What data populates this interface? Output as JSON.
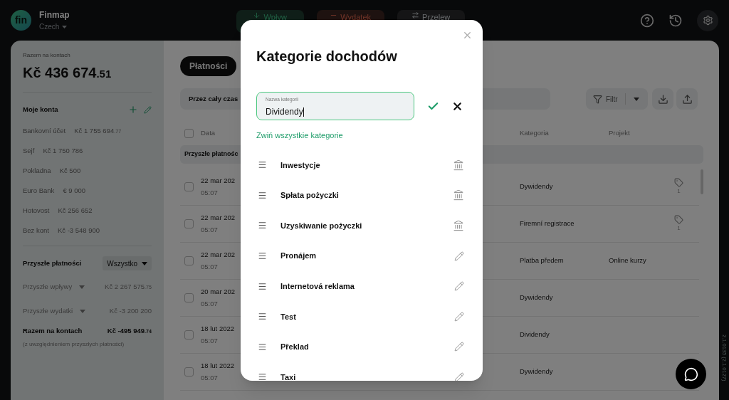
{
  "app": {
    "name": "Finmap",
    "language": "Czech",
    "logo": "fin"
  },
  "top_buttons": [
    {
      "label": "Wpływ",
      "kind": "income"
    },
    {
      "label": "Wydatek",
      "kind": "expense"
    },
    {
      "label": "Przelew",
      "kind": "transfer"
    }
  ],
  "sidebar": {
    "total_label": "Razem na kontach",
    "total": "Kč 436 674",
    "total_cents": ".51",
    "accounts_title": "Moje konta",
    "accounts": [
      {
        "name": "Bankovní účet",
        "amount": "Kč 1 755 694",
        "cents": ".77"
      },
      {
        "name": "Sejf",
        "amount": "Kč 1 750 786"
      },
      {
        "name": "Pokladna",
        "amount": "Kč 500"
      },
      {
        "name": "Euro Bank",
        "amount": "€ 9 000"
      },
      {
        "name": "Hotovost",
        "amount": "Kč 256 652"
      },
      {
        "name": "Bez kont",
        "amount": "Kč -3 548 900"
      }
    ],
    "future_title": "Przyszłe płatności",
    "future_filter": "Wszystko",
    "future": [
      {
        "name": "Przyszłe wpływy",
        "amount": "Kč 2 267 575",
        "cents": ".75"
      },
      {
        "name": "Przyszłe wydatki",
        "amount": "Kč -3 200 200"
      }
    ],
    "grand_label": "Razem na kontach",
    "grand_total": "Kč -495 949",
    "grand_cents": ".74",
    "grand_note": "(z uwzględnieniem przyszłych płatności)"
  },
  "tabs": [
    {
      "label": "Płatności",
      "selected": true
    }
  ],
  "period": "Przez cały czas",
  "filter_button": "Filtr",
  "table": {
    "select_all_checked": false,
    "columns": [
      "Data",
      "Kategoria",
      "Projekt"
    ],
    "group": "Przyszłe płatnośc",
    "rows": [
      {
        "checked": false,
        "date": "22 mar 202",
        "time": "05:07",
        "category": "Dywidendy",
        "tags": "1"
      },
      {
        "checked": false,
        "date": "22 mar 202",
        "time": "05:07",
        "category": "Firemní registrace",
        "tags": "1"
      },
      {
        "checked": false,
        "date": "22 mar 202",
        "time": "05:07",
        "category": "Platba předem",
        "project": "Online kurzy"
      },
      {
        "checked": false,
        "date": "20 mar 202",
        "time": "05:07",
        "category": "Dywidendy"
      },
      {
        "checked": false,
        "date": "18 lut 2022",
        "time": "05:07",
        "category": "Dividendy"
      },
      {
        "checked": false,
        "date": "18 lut 2022",
        "time": "05:07",
        "category": "Dywidendy"
      }
    ]
  },
  "version": "2.1.0135 (2.1.0127)",
  "modal": {
    "title": "Kategorie dochodów",
    "field": {
      "label": "Nazwa kategorii",
      "value": "Dividendy"
    },
    "collapse_link": "Zwiń wszystkie kategorie",
    "categories": [
      {
        "name": "Inwestycje",
        "kind": "system"
      },
      {
        "name": "Spłata pożyczki",
        "kind": "system"
      },
      {
        "name": "Uzyskiwanie pożyczki",
        "kind": "system"
      },
      {
        "name": "Pronájem",
        "kind": "custom"
      },
      {
        "name": "Internetová reklama",
        "kind": "custom"
      },
      {
        "name": "Test",
        "kind": "custom"
      },
      {
        "name": "Překlad",
        "kind": "custom"
      },
      {
        "name": "Taxi",
        "kind": "custom"
      }
    ]
  }
}
